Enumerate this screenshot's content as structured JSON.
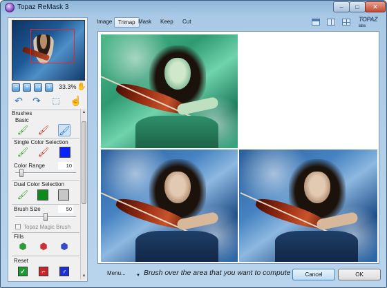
{
  "window": {
    "title": "Topaz ReMask 3",
    "minimize_glyph": "–",
    "maximize_glyph": "□",
    "close_glyph": "✕"
  },
  "navigator": {
    "zoom": "33.3%",
    "zoom_buttons": [
      "zoom-in",
      "zoom-out",
      "fit",
      "actual-size"
    ],
    "tools": [
      "undo-icon",
      "redo-icon",
      "select-icon",
      "hand-icon"
    ]
  },
  "brushes": {
    "header": "Brushes",
    "basic_label": "Basic",
    "single_color_label": "Single Color Selection",
    "single_color_swatch": "#0b21ff",
    "color_range_label": "Color Range",
    "color_range_value": "10",
    "color_range_level": 0.1,
    "dual_color_label": "Dual Color Selection",
    "dual_color_swatches": [
      "#0e8a1b",
      "#c7c7c7"
    ],
    "brush_size_label": "Brush Size",
    "brush_size_value": "50",
    "brush_size_level": 0.5,
    "magic_brush_label": "Topaz Magic Brush",
    "fills_label": "Fills",
    "reset_label": "Reset"
  },
  "toolbar": {
    "tabs": [
      "Image",
      "Trimap",
      "Mask",
      "Keep",
      "Cut"
    ],
    "active_tab": "Trimap",
    "logo_line1": "TOPAZ",
    "logo_line2": "labs"
  },
  "bottom": {
    "menu_label": "Menu...",
    "hint": "Brush over the area that you want to compute",
    "cancel_label": "Cancel",
    "ok_label": "OK"
  },
  "colors": {
    "accent": "#6f9ed0",
    "single_swatch": "#0b21ff",
    "dual_swatch_a": "#0e8a1b",
    "dual_swatch_b": "#c7c7c7"
  }
}
